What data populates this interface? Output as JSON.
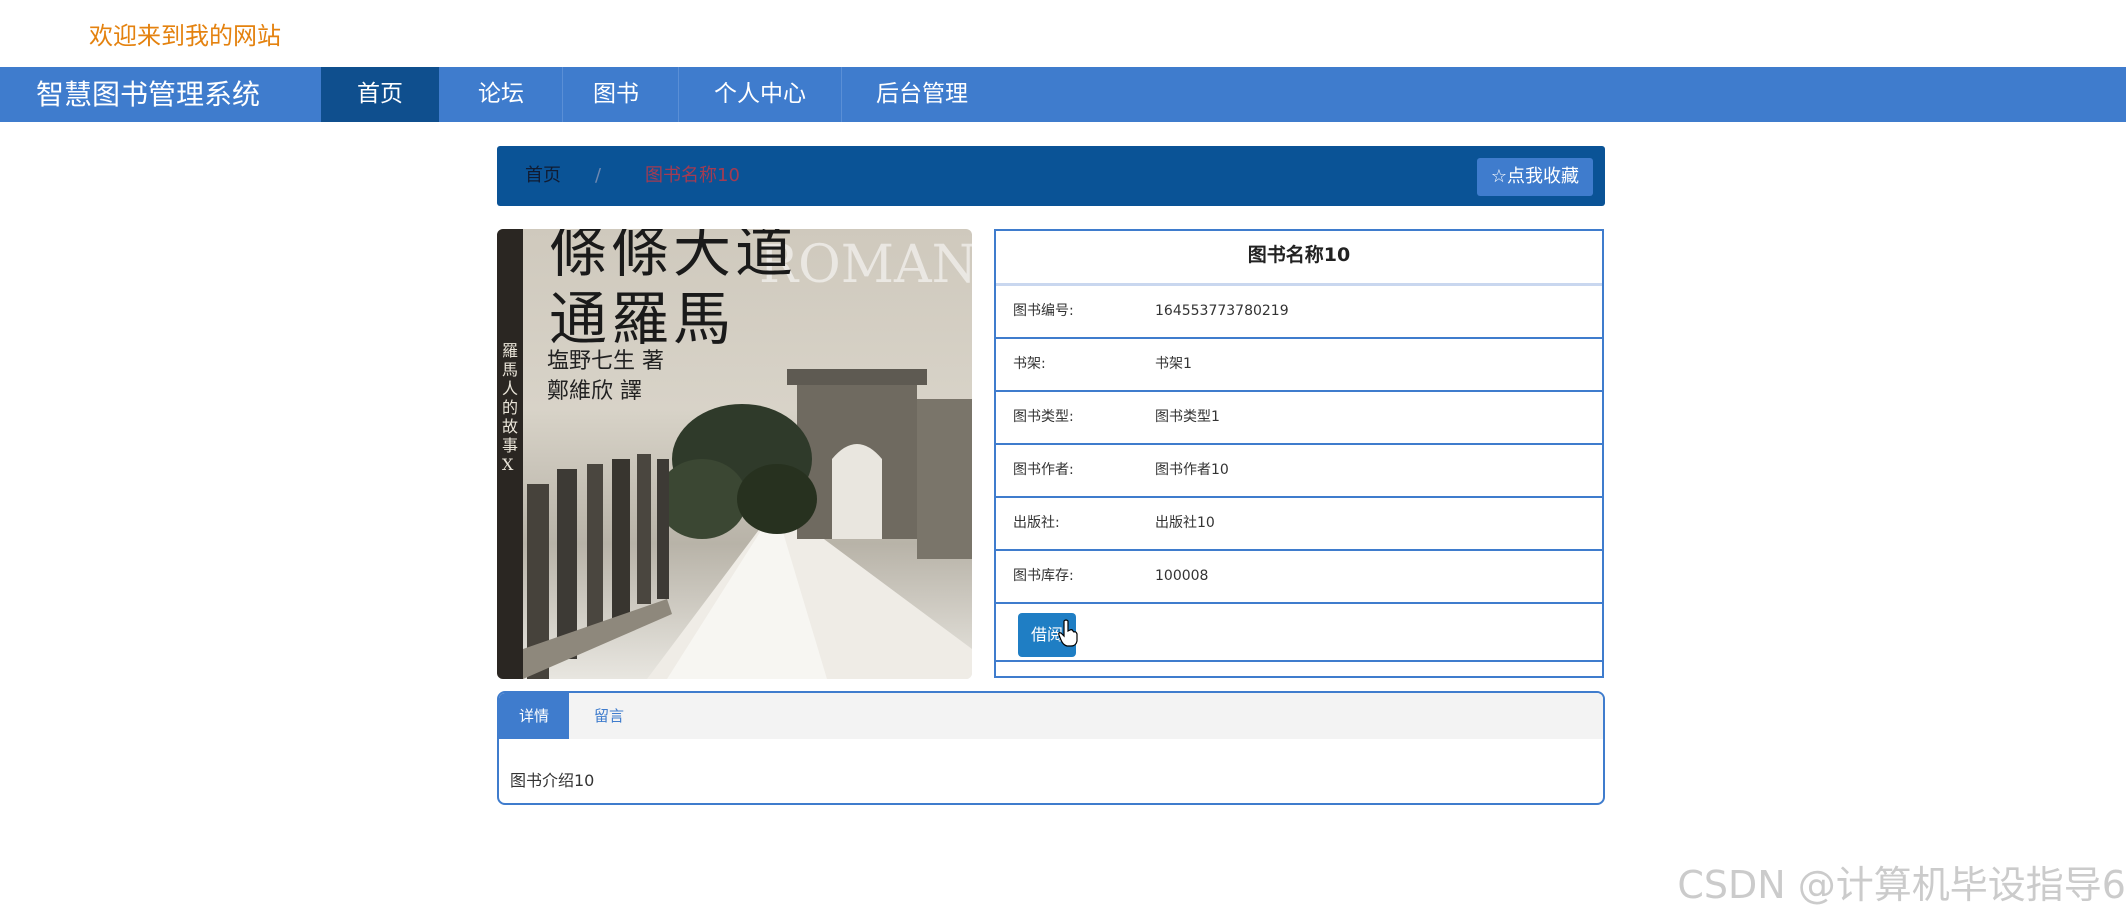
{
  "welcome_text": "欢迎来到我的网站",
  "navbar": {
    "brand": "智慧图书管理系统",
    "items": [
      {
        "label": "首页",
        "active": true
      },
      {
        "label": "论坛",
        "active": false
      },
      {
        "label": "图书",
        "active": false
      },
      {
        "label": "个人中心",
        "active": false
      },
      {
        "label": "后台管理",
        "active": false
      }
    ]
  },
  "breadcrumb": {
    "home": "首页",
    "separator": "/",
    "current": "图书名称10",
    "favorite_button": "☆点我收藏"
  },
  "cover": {
    "title_line1": "條條大道",
    "title_line2": "通羅馬",
    "english_text": "ROMAN",
    "author_line1": "塩野七生 著",
    "author_line2": "鄭維欣 譯",
    "spine_text": "羅馬人的故事X"
  },
  "book": {
    "title": "图书名称10",
    "fields": [
      {
        "label": "图书编号:",
        "value": "164553773780219"
      },
      {
        "label": "书架:",
        "value": "书架1"
      },
      {
        "label": "图书类型:",
        "value": "图书类型1"
      },
      {
        "label": "图书作者:",
        "value": "图书作者10"
      },
      {
        "label": "出版社:",
        "value": "出版社10"
      },
      {
        "label": "图书库存:",
        "value": "100008"
      }
    ],
    "borrow_button": "借阅"
  },
  "tabs": {
    "items": [
      {
        "label": "详情",
        "active": true
      },
      {
        "label": "留言",
        "active": false
      }
    ],
    "content": "图书介绍10"
  },
  "watermark": "CSDN @计算机毕设指导6",
  "colors": {
    "nav_bg": "#3f7ccd",
    "nav_active": "#0f4f8e",
    "breadcrumb_bg": "#0a5396",
    "welcome": "#e4820f",
    "borrow_button": "#1f7ec4"
  }
}
